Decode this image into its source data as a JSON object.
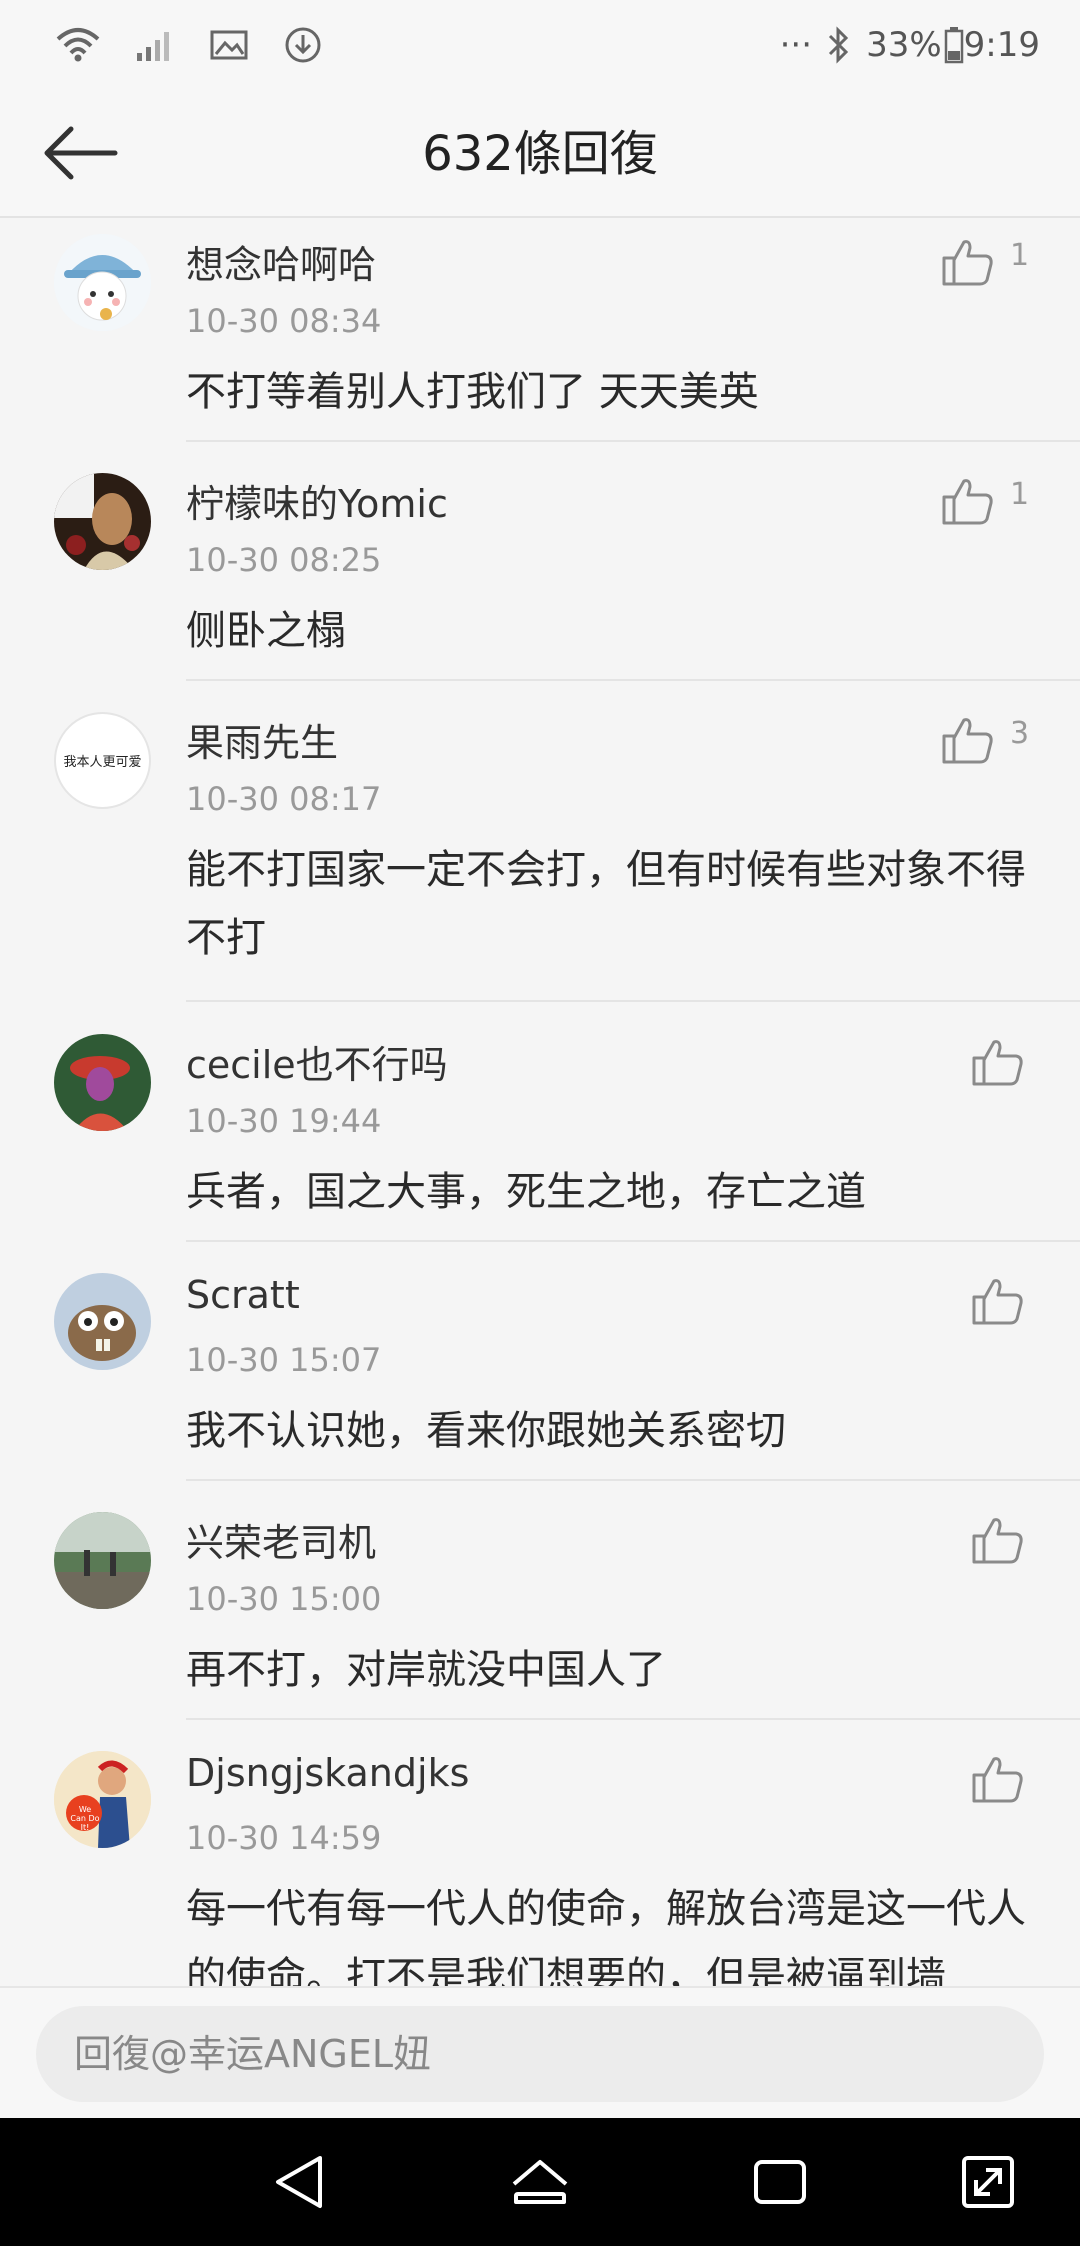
{
  "status_bar": {
    "battery": "33%",
    "time": "9:19",
    "more": "···"
  },
  "header": {
    "title": "632條回復"
  },
  "comments": [
    {
      "username": "想念哈啊哈",
      "time": "10-30 08:34",
      "text": "不打等着别人打我们了 天天美英",
      "likes": "1"
    },
    {
      "username": "柠檬味的Yomic",
      "time": "10-30 08:25",
      "text": "侧卧之榻",
      "likes": "1"
    },
    {
      "username": "果雨先生",
      "time": "10-30 08:17",
      "text": "能不打国家一定不会打，但有时候有些对象不得不打",
      "likes": "3",
      "avatar_text": "我本人更可爱"
    },
    {
      "username": "cecile也不行吗",
      "time": "10-30 19:44",
      "text": "兵者，国之大事，死生之地，存亡之道",
      "likes": ""
    },
    {
      "username": "Scratt",
      "time": "10-30 15:07",
      "text": "我不认识她，看来你跟她关系密切",
      "likes": ""
    },
    {
      "username": "兴荣老司机",
      "time": "10-30 15:00",
      "text": "再不打，对岸就没中国人了",
      "likes": ""
    },
    {
      "username": "Djsngjskandjks",
      "time": "10-30 14:59",
      "text": "每一代有每一代人的使命，解放台湾是这一代人的使命。打不是我们想要的，但是被逼到墙",
      "likes": "",
      "avatar_text": "We Can Do It!"
    }
  ],
  "reply": {
    "placeholder": "回復@幸运ANGEL妞"
  }
}
